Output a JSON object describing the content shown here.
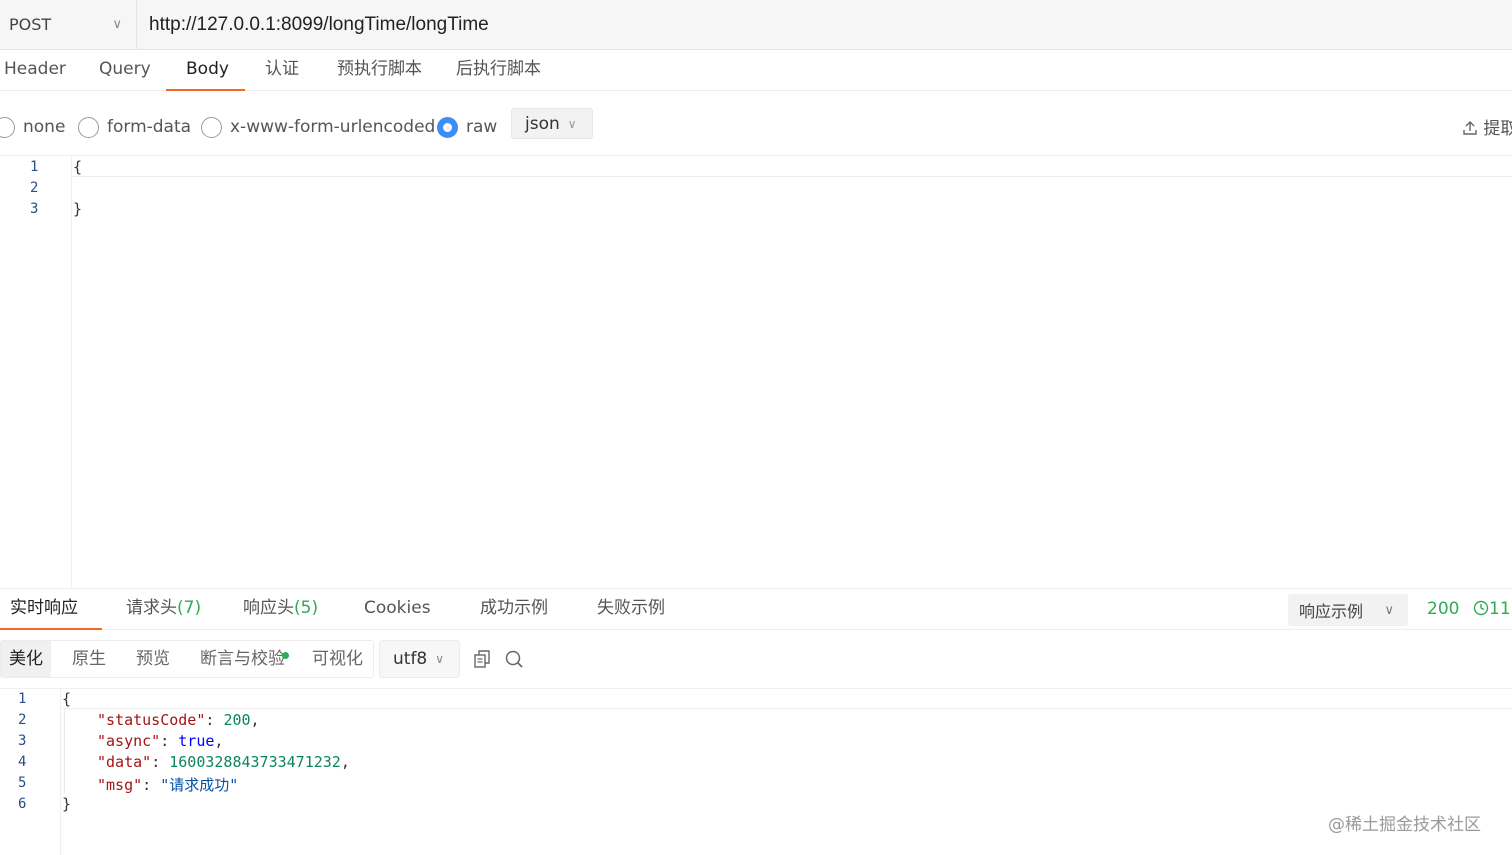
{
  "request": {
    "method": "POST",
    "url": "http://127.0.0.1:8099/longTime/longTime"
  },
  "request_tabs": [
    "Header",
    "Query",
    "Body",
    "认证",
    "预执行脚本",
    "后执行脚本"
  ],
  "active_request_tab": "Body",
  "body_types": [
    "none",
    "form-data",
    "x-www-form-urlencoded",
    "raw"
  ],
  "selected_body_type": "raw",
  "body_format": "json",
  "extract_label": "提取",
  "request_body": {
    "line_numbers": [
      "1",
      "2",
      "3"
    ],
    "lines": [
      "{",
      "",
      "}"
    ]
  },
  "response_tabs": {
    "realtime": "实时响应",
    "req_headers": "请求头",
    "req_headers_count": "(7)",
    "res_headers": "响应头",
    "res_headers_count": "(5)",
    "cookies": "Cookies",
    "success_example": "成功示例",
    "fail_example": "失败示例"
  },
  "response_example_label": "响应示例",
  "status_code": "200",
  "time_value": "11",
  "response_views": [
    "美化",
    "原生",
    "预览",
    "断言与校验",
    "可视化"
  ],
  "active_response_view": "美化",
  "encoding": "utf8",
  "response_body": {
    "line_numbers": [
      "1",
      "2",
      "3",
      "4",
      "5",
      "6"
    ],
    "open_brace": "{",
    "close_brace": "}",
    "fields": [
      {
        "key": "\"statusCode\"",
        "value": "200",
        "type": "number",
        "comma": ","
      },
      {
        "key": "\"async\"",
        "value": "true",
        "type": "bool",
        "comma": ","
      },
      {
        "key": "\"data\"",
        "value": "1600328843733471232",
        "type": "number",
        "comma": ","
      },
      {
        "key": "\"msg\"",
        "value": "\"请求成功\"",
        "type": "string",
        "comma": ""
      }
    ]
  },
  "watermark": "@稀土掘金技术社区",
  "colors": {
    "accent_tab_underline": "#f06a2e",
    "success_green": "#2eab56",
    "radio_selected": "#3d8ef0"
  }
}
